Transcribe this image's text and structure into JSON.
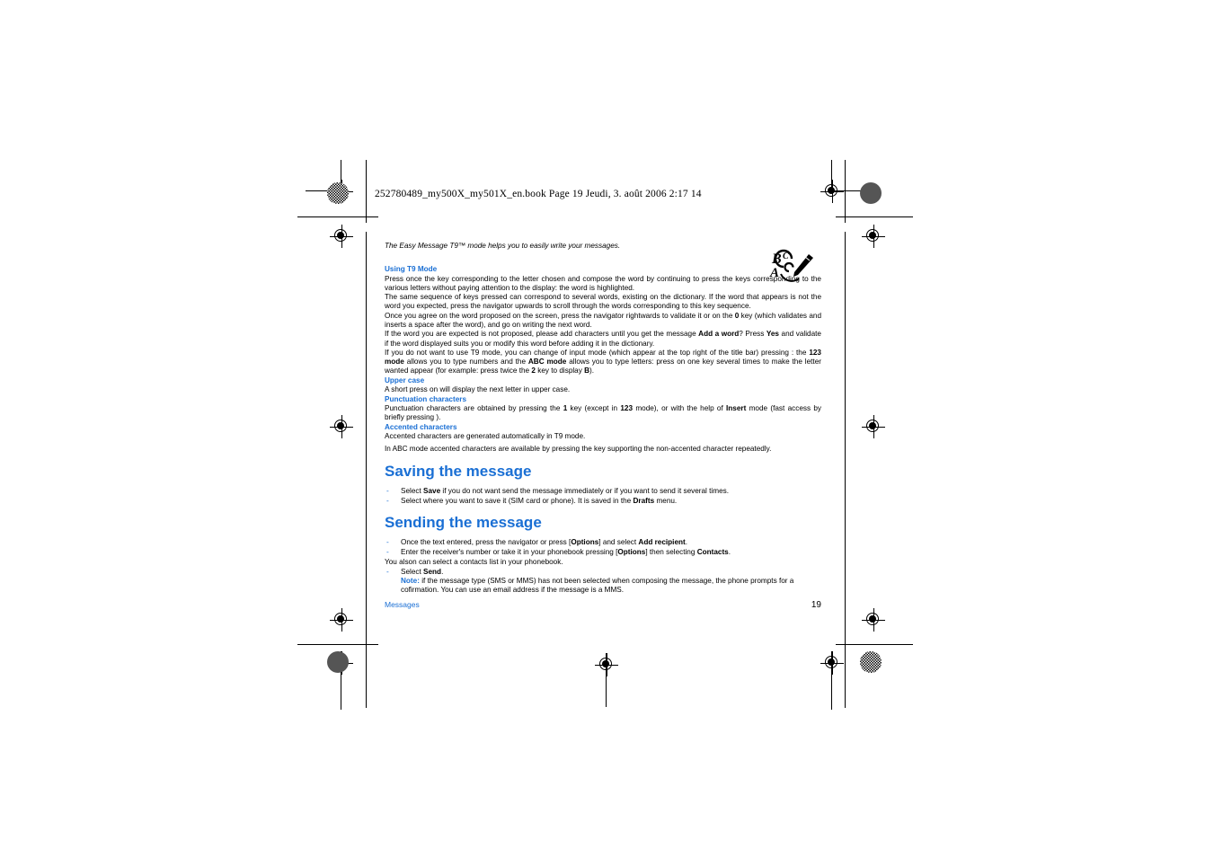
{
  "print_marks": {
    "slug_line": "252780489_my500X_my501X_en.book  Page 19  Jeudi, 3. août 2006  2:17 14"
  },
  "page": {
    "intro": "The Easy Message T9™ mode helps you to easily write your messages.",
    "icon_name": "abc-t9-pen-icon",
    "sections": {
      "using_t9": {
        "heading": "Using T9 Mode",
        "paragraphs": [
          "Press once the key corresponding to the letter chosen and compose the word by continuing to press the keys corresponding to the various letters without paying attention to the display: the word is highlighted.",
          "The same sequence of keys pressed can correspond to several words, existing on the dictionary. If the word that appears is not the word you expected, press the navigator upwards to scroll through the words corresponding to this key sequence."
        ],
        "para_once_pre": "Once you agree on the word proposed on the screen, press the navigator rightwards to validate it or on the ",
        "para_once_b1": "0",
        "para_once_post": " key (which validates and inserts a space after the word), and go on writing the next word.",
        "para_add_pre": "If the word you are expected is not proposed, please add characters until you get the message ",
        "para_add_b1": "Add a word",
        "para_add_mid": "? Press ",
        "para_add_b2": "Yes",
        "para_add_post": " and validate if the word displayed suits you or modify this word before adding it in the dictionary.",
        "para_mode_pre": "If you do not want to use T9 mode, you can change of input mode (which appear at the top right of the title bar) pressing   : the ",
        "para_mode_b1": "123 mode",
        "para_mode_mid1": " allows you to type numbers and the ",
        "para_mode_b2": "ABC mode",
        "para_mode_mid2": " allows you to type letters: press on one key several times to make the letter wanted appear (for example: press twice the ",
        "para_mode_b3": "2",
        "para_mode_mid3": " key to display ",
        "para_mode_b4": "B",
        "para_mode_post": ")."
      },
      "upper_case": {
        "heading": "Upper case",
        "text": "A short press on    will display the next letter in upper case."
      },
      "punctuation": {
        "heading": "Punctuation characters",
        "pre": "Punctuation characters are obtained by pressing the ",
        "b1": "1",
        "mid1": " key (except in ",
        "b2": "123",
        "mid2": " mode), or with the help of ",
        "b3": "Insert",
        "post": " mode (fast access by briefly pressing   )."
      },
      "accented": {
        "heading": "Accented characters",
        "line1": "Accented characters are generated automatically in T9 mode.",
        "line2": "In ABC mode accented characters are available by pressing the key supporting the non-accented character repeatedly."
      },
      "saving": {
        "heading": "Saving the message",
        "items": [
          {
            "pre": "Select ",
            "b": "Save",
            "post": " if you do not want send the message immediately or if you want to send it several times."
          },
          {
            "pre": "Select where you want to save it (SIM card or phone). It is saved in the ",
            "b": "Drafts",
            "post": " menu."
          }
        ]
      },
      "sending": {
        "heading": "Sending the message",
        "item1_pre": "Once the text entered, press the navigator or press [",
        "item1_b1": "Options",
        "item1_mid": "] and select ",
        "item1_b2": "Add recipient",
        "item1_post": ".",
        "item2_pre": "Enter the receiver's number or take it in your phonebook pressing [",
        "item2_b1": "Options",
        "item2_mid": "] then selecting ",
        "item2_b2": "Contacts",
        "item2_post": ".",
        "plain_line": "You alson can select a contacts list in your phonebook.",
        "item3_pre": "Select ",
        "item3_b": "Send",
        "item3_post": ".",
        "note_label": "Note:",
        "note_text": " if the message type (SMS or MMS) has not been selected when composing the message, the phone prompts for a cofirmation. You can use an email address if the message is a MMS."
      }
    }
  },
  "footer": {
    "chapter": "Messages",
    "page_number": "19"
  },
  "colors": {
    "heading_blue": "#1a6fd4",
    "text_black": "#000000",
    "background": "#ffffff"
  }
}
